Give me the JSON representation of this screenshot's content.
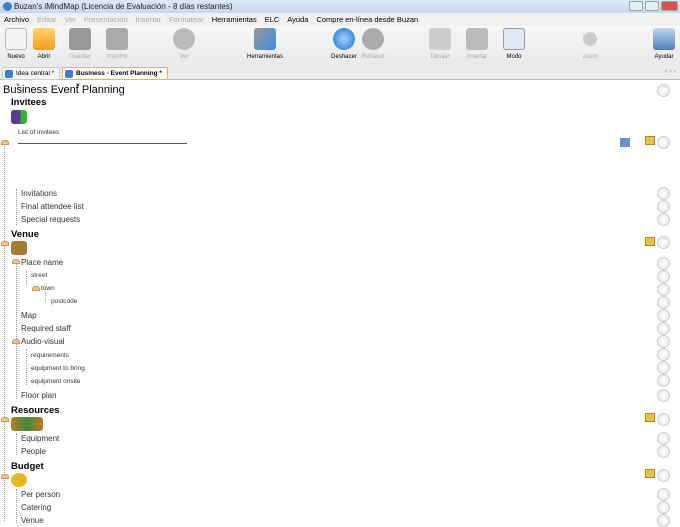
{
  "window": {
    "title": "Buzan's iMindMap (Licencia de Evaluación -   8 días restantes)"
  },
  "menu": [
    "Archivo",
    "Editar",
    "Ver",
    "Presentación",
    "Insertar",
    "Formatear",
    "Herramientas",
    "ELC",
    "Ayuda",
    "Compre en-línea desde Buzan"
  ],
  "toolbar": {
    "nuevo": "Nuevo",
    "abrir": "Abrir",
    "guardar": "Guardar",
    "imprimir": "Imprimir",
    "ver": "Ver",
    "herramientas": "Herramientas",
    "deshacer": "Deshacer",
    "rehacer": "Rehacer",
    "dibujar": "Dibujar",
    "insertar": "Insertar",
    "modo": "Modo",
    "zoom": "zoom",
    "ayudar": "Ayudar"
  },
  "tabs": [
    "Idea central *",
    "Business - Event Planning *"
  ],
  "map": {
    "title": "Business Event Planning",
    "invitees": {
      "label": "Invitees",
      "note": "List of invitees",
      "items": [
        "Invitations",
        "Final attendee list",
        "Special requests"
      ]
    },
    "venue": {
      "label": "Venue",
      "place": "Place name",
      "street": "street",
      "town": "town",
      "postcode": "postcode",
      "items": [
        "Map",
        "Required staff"
      ],
      "av": "Audio-visual",
      "av_items": [
        "requirements",
        "equipment to bring",
        "equipment onsite"
      ],
      "floor": "Floor plan"
    },
    "resources": {
      "label": "Resources",
      "items": [
        "Equipment",
        "People"
      ]
    },
    "budget": {
      "label": "Budget",
      "items": [
        "Per person",
        "Catering",
        "Venue"
      ]
    }
  }
}
